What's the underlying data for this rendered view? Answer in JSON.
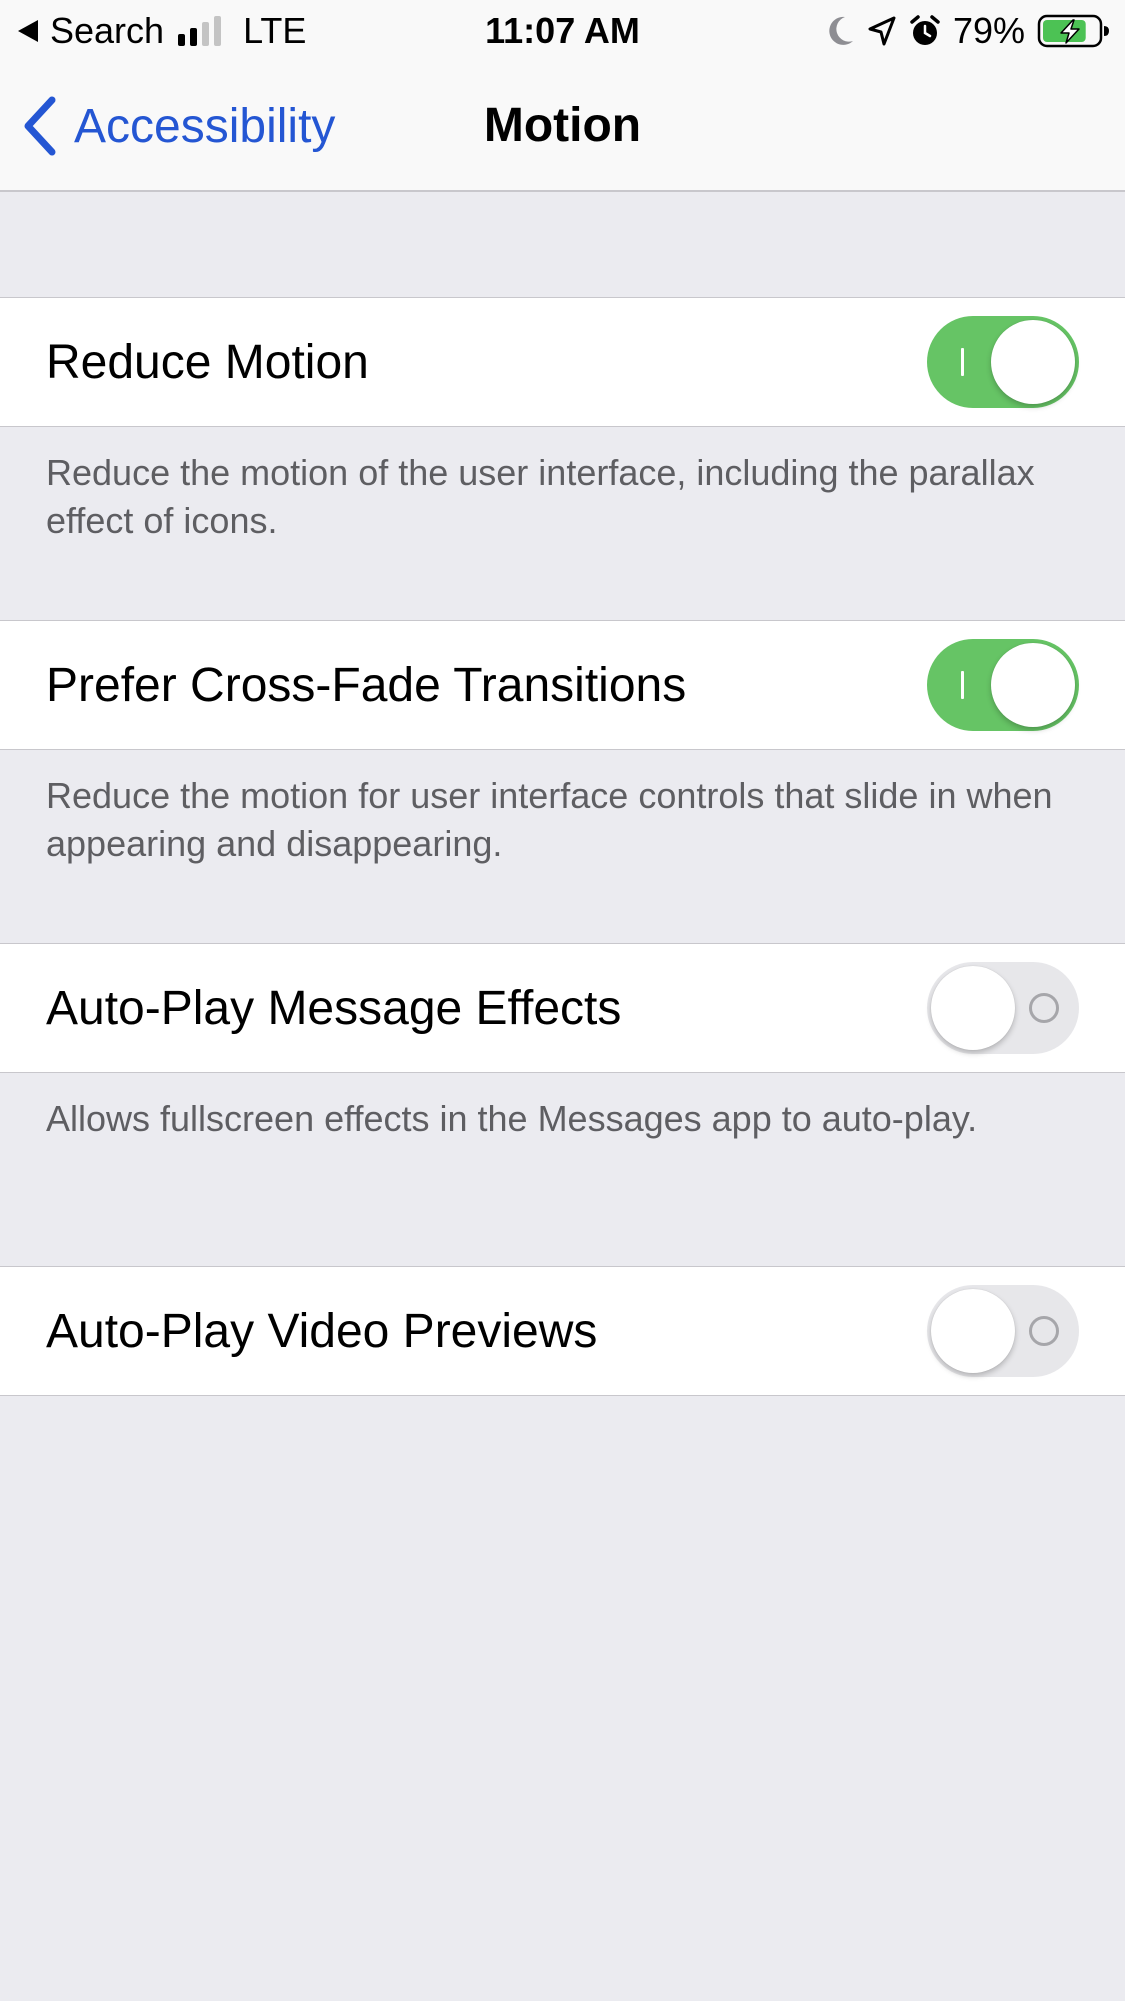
{
  "status_bar": {
    "back_app": "Search",
    "carrier": "LTE",
    "time": "11:07 AM",
    "battery_percent": "79%",
    "battery_level": 0.79,
    "signal_bars_filled": 2,
    "signal_bars_total": 4,
    "icons": [
      "back-triangle-icon",
      "signal-icon",
      "moon-icon",
      "location-icon",
      "alarm-icon",
      "battery-charging-icon"
    ]
  },
  "nav": {
    "back_label": "Accessibility",
    "title": "Motion",
    "back_icon": "chevron-left-icon"
  },
  "settings": [
    {
      "label": "Reduce Motion",
      "enabled": true,
      "footer": "Reduce the motion of the user interface, including the parallax effect of icons."
    },
    {
      "label": "Prefer Cross-Fade Transitions",
      "enabled": true,
      "footer": "Reduce the motion for user interface controls that slide in when appearing and disappearing."
    },
    {
      "label": "Auto-Play Message Effects",
      "enabled": false,
      "footer": "Allows fullscreen effects in the Messages app to auto-play."
    },
    {
      "label": "Auto-Play Video Previews",
      "enabled": false,
      "footer": ""
    }
  ],
  "colors": {
    "accent": "#2456d3",
    "toggle_on": "#66c465",
    "toggle_off": "#e7e7ea",
    "background": "#ebebf0",
    "footer_text": "#5e5e62"
  }
}
